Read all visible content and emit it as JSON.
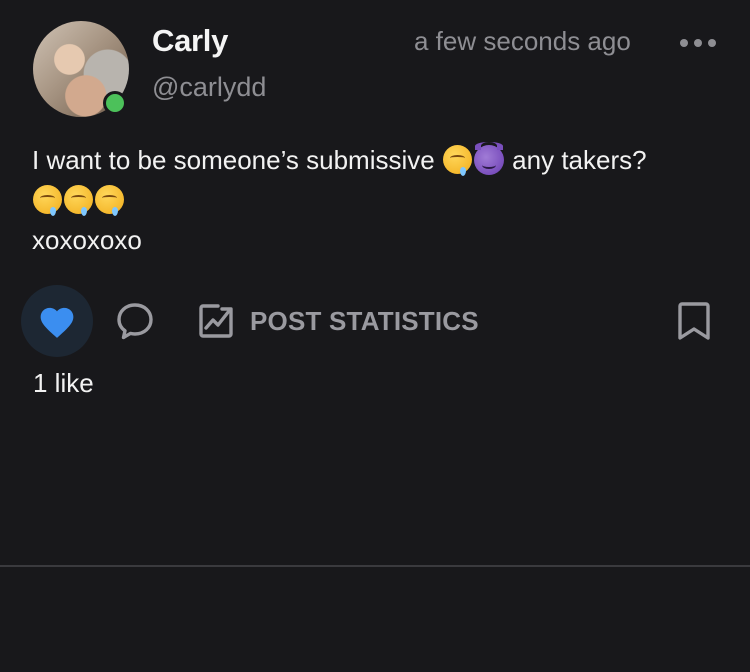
{
  "post": {
    "author": {
      "display_name": "Carly",
      "handle": "@carlydd",
      "online": true
    },
    "timestamp": "a few seconds ago",
    "text": {
      "line1_before": "I want to be someone’s submissive ",
      "line1_after": " any takers?",
      "line3": "xoxoxoxo"
    },
    "emojis": {
      "drool": "drooling-face",
      "devil": "smiling-face-with-horns"
    },
    "actions": {
      "post_statistics_label": "POST STATISTICS",
      "liked": true
    },
    "like_count_text": "1 like"
  },
  "colors": {
    "background": "#18181b",
    "like_accent": "#3b8ef0",
    "online": "#4cc15a",
    "muted_text": "#8e8e93"
  }
}
